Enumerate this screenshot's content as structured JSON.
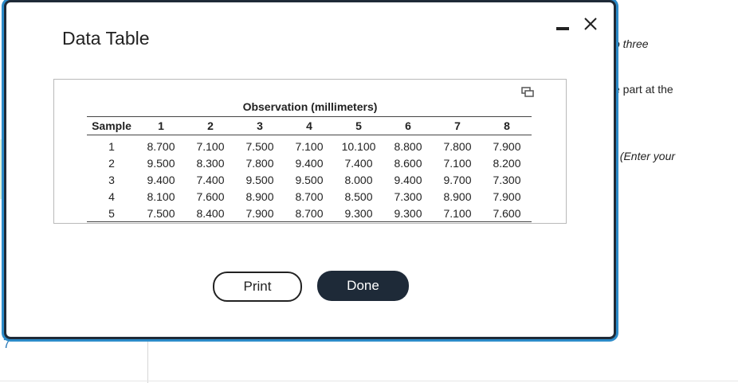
{
  "background": {
    "snippets": [
      "o three",
      "e part at the",
      ". (Enter your"
    ],
    "number": "7"
  },
  "dialog": {
    "title": "Data Table",
    "minimize_icon": "minimize-icon",
    "close_icon": "close-icon",
    "copy_icon": "copy-icon",
    "table": {
      "group_header": "Observation (millimeters)",
      "columns": [
        "Sample",
        "1",
        "2",
        "3",
        "4",
        "5",
        "6",
        "7",
        "8"
      ],
      "rows": [
        [
          "1",
          "8.700",
          "7.100",
          "7.500",
          "7.100",
          "10.100",
          "8.800",
          "7.800",
          "7.900"
        ],
        [
          "2",
          "9.500",
          "8.300",
          "7.800",
          "9.400",
          "7.400",
          "8.600",
          "7.100",
          "8.200"
        ],
        [
          "3",
          "9.400",
          "7.400",
          "9.500",
          "9.500",
          "8.000",
          "9.400",
          "9.700",
          "7.300"
        ],
        [
          "4",
          "8.100",
          "7.600",
          "8.900",
          "8.700",
          "8.500",
          "7.300",
          "8.900",
          "7.900"
        ],
        [
          "5",
          "7.500",
          "8.400",
          "7.900",
          "8.700",
          "9.300",
          "9.300",
          "7.100",
          "7.600"
        ]
      ]
    },
    "buttons": {
      "print": "Print",
      "done": "Done"
    }
  },
  "colors": {
    "accent": "#2c8bc9",
    "done_bg": "#1e2a38",
    "frame": "#1f2a37"
  }
}
